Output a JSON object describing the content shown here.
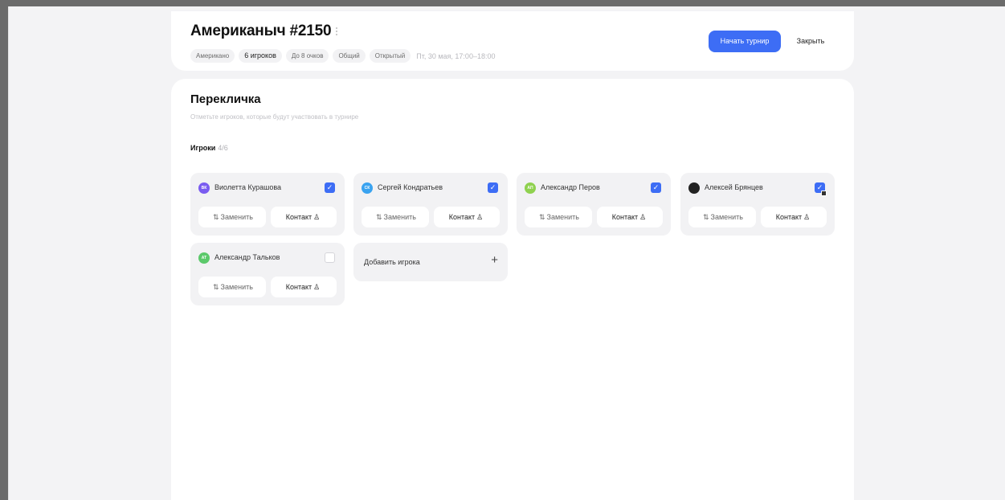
{
  "header": {
    "title": "Американыч #2150",
    "tags": [
      "Американо",
      "6 игроков",
      "До 8 очков",
      "Общий",
      "Открытый"
    ],
    "date": "Пт, 30 мая, 17:00–18:00",
    "start_label": "Начать турнир",
    "close_label": "Закрыть"
  },
  "rollcall": {
    "title": "Перекличка",
    "subtitle": "Отметьте игроков, которые будут участвовать в турнире",
    "players_label": "Игроки",
    "players_count": "4/6",
    "replace_label": "Заменить",
    "contact_label": "Контакт",
    "add_label": "Добавить игрока",
    "players": [
      {
        "name": "Виолетта Курашова",
        "initials": "ВК",
        "avatar_color": "#7a5cf0",
        "checked": true
      },
      {
        "name": "Сергей Кондратьев",
        "initials": "СК",
        "avatar_color": "#3aa3f0",
        "checked": true
      },
      {
        "name": "Александр Перов",
        "initials": "АП",
        "avatar_color": "#8fd14f",
        "checked": true
      },
      {
        "name": "Алексей Брянцев",
        "initials": "",
        "avatar_color": "#222222",
        "checked": true
      },
      {
        "name": "Александр Тальков",
        "initials": "АТ",
        "avatar_color": "#5cc96b",
        "checked": false
      }
    ]
  },
  "colors": {
    "accent": "#3d6df5",
    "card_bg": "#f2f2f4"
  }
}
